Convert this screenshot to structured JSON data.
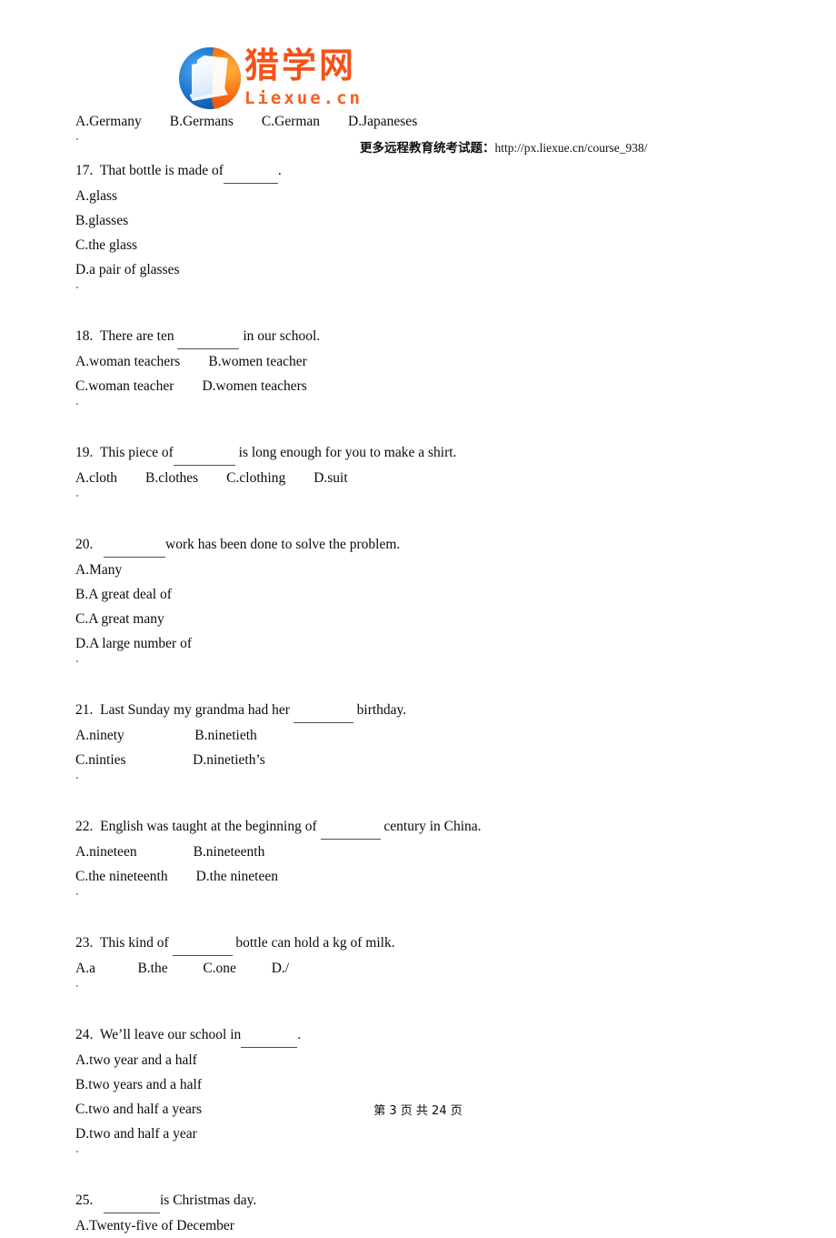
{
  "header": {
    "logo": {
      "cn_name": "猎学网",
      "en_name": "Liexue.cn",
      "mark": "circular-book-logo",
      "colors": {
        "blue": "#1b71c8",
        "orange": "#f4521a"
      }
    },
    "note_cn": "更多远程教育统考试题：",
    "note_url": "http://px.liexue.cn/course_938/"
  },
  "content": {
    "prev_options_line": "A.Germany        B.Germans        C.German        D.Japaneses",
    "questions": [
      {
        "number": "17.",
        "stem_before": "That bottle is made of",
        "blank_width": 60,
        "stem_after": ".",
        "option_lines": [
          "A.glass",
          "B.glasses",
          "C.the glass",
          "D.a pair of glasses"
        ]
      },
      {
        "number": "18.",
        "stem_before": "There are ten ",
        "blank_width": 68,
        "stem_after": " in our school.",
        "option_lines": [
          "A.woman teachers        B.women teacher",
          "C.woman teacher        D.women teachers"
        ]
      },
      {
        "number": "19.",
        "stem_before": "This piece of",
        "blank_width": 68,
        "stem_after": " is long enough for you to make a shirt.",
        "option_lines": [
          "A.cloth        B.clothes        C.clothing        D.suit"
        ]
      },
      {
        "number": "20.",
        "stem_before": " ",
        "blank_width": 68,
        "stem_after": "work has been done to solve the problem.",
        "option_lines": [
          "A.Many",
          "B.A great deal of",
          "C.A great many",
          "D.A large number of"
        ]
      },
      {
        "number": "21.",
        "stem_before": "Last Sunday my grandma had her ",
        "blank_width": 66,
        "stem_after": " birthday.",
        "option_lines": [
          "A.ninety                    B.ninetieth",
          "C.ninties                   D.ninetieth’s"
        ]
      },
      {
        "number": "22.",
        "stem_before": "English was taught at the beginning of ",
        "blank_width": 66,
        "stem_after": " century in China.",
        "option_lines": [
          "A.nineteen                B.nineteenth",
          "C.the nineteenth        D.the nineteen"
        ]
      },
      {
        "number": "23.",
        "stem_before": "This kind of ",
        "blank_width": 66,
        "stem_after": " bottle can hold a kg of milk.",
        "option_lines": [
          "A.a            B.the          C.one          D./"
        ]
      },
      {
        "number": "24.",
        "stem_before": "We’ll leave our school in",
        "blank_width": 62,
        "stem_after": ".",
        "option_lines": [
          "A.two year and a half",
          "B.two years and a half",
          "C.two and half a years",
          "D.two and half a year"
        ]
      },
      {
        "number": "25.",
        "stem_before": " ",
        "blank_width": 62,
        "stem_after": "is Christmas day.",
        "option_lines": [
          "A.Twenty-five of December"
        ]
      }
    ]
  },
  "footer": {
    "text": "第 3 页 共 24 页",
    "page_current": "3",
    "page_total": "24"
  }
}
